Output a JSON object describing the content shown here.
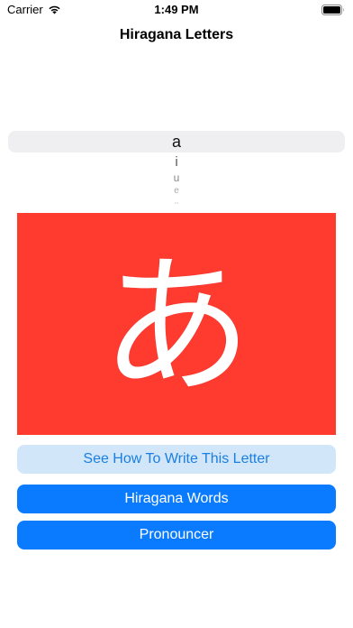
{
  "status_bar": {
    "carrier": "Carrier",
    "time": "1:49 PM",
    "icons": [
      "wifi-icon",
      "battery-icon"
    ]
  },
  "nav": {
    "title": "Hiragana Letters"
  },
  "picker": {
    "selected": "a",
    "items": [
      "a",
      "i",
      "u",
      "e",
      "o"
    ]
  },
  "letter_card": {
    "glyph": "あ",
    "background_color": "#ff3b30"
  },
  "buttons": {
    "write": "See How To Write This Letter",
    "words": "Hiragana Words",
    "pronouncer": "Pronouncer"
  },
  "colors": {
    "primary_blue": "#0a7bff",
    "light_blue": "#d2e6fa"
  }
}
